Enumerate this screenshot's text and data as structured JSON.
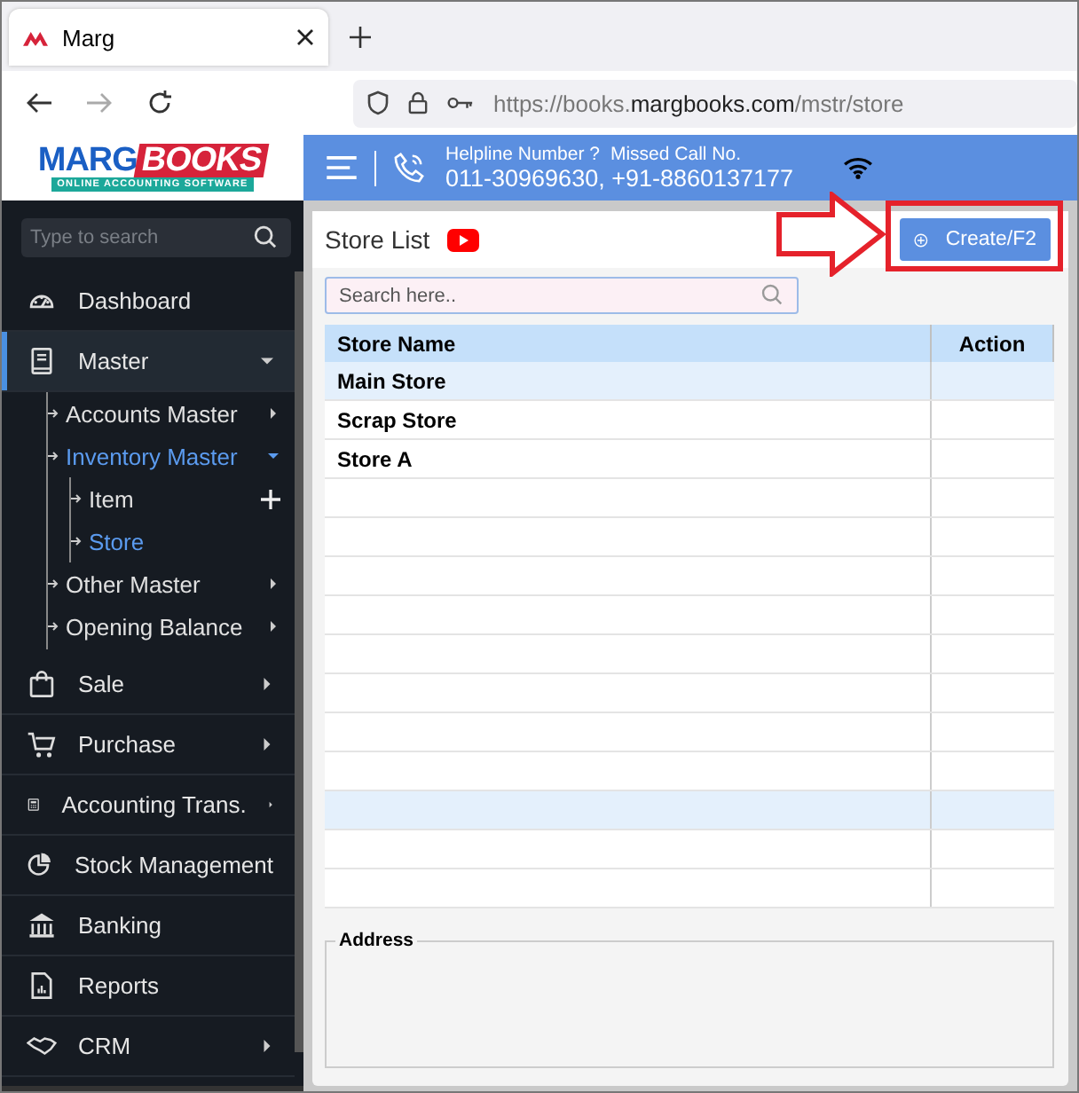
{
  "browser": {
    "tab": {
      "title": "Marg"
    },
    "url": {
      "prefix": "https://books.",
      "domain": "margbooks.com",
      "path": "/mstr/store"
    }
  },
  "logo": {
    "left": "MARG",
    "right": "BOOKS",
    "tagline": "ONLINE ACCOUNTING SOFTWARE"
  },
  "header": {
    "helpline_label": "Helpline Number ?",
    "missed_call_label": "Missed Call No.",
    "numbers": "011-30969630, +91-8860137177"
  },
  "sidebar": {
    "search": {
      "placeholder": "Type to search"
    },
    "items": [
      {
        "label": "Dashboard",
        "kind": "link",
        "selected": false
      },
      {
        "label": "Master",
        "kind": "menu",
        "expanded": true,
        "selected": true,
        "children": [
          {
            "label": "Accounts Master",
            "kind": "menu",
            "expanded": false,
            "selected": false
          },
          {
            "label": "Inventory Master",
            "kind": "menu",
            "expanded": true,
            "selected": true,
            "children": [
              {
                "label": "Item",
                "kind": "add",
                "selected": false
              },
              {
                "label": "Store",
                "kind": "link",
                "selected": true
              }
            ]
          },
          {
            "label": "Other Master",
            "kind": "menu",
            "expanded": false,
            "selected": false
          },
          {
            "label": "Opening Balance",
            "kind": "menu",
            "expanded": false,
            "selected": false
          }
        ]
      },
      {
        "label": "Sale",
        "kind": "menu",
        "expanded": false,
        "selected": false
      },
      {
        "label": "Purchase",
        "kind": "menu",
        "expanded": false,
        "selected": false
      },
      {
        "label": "Accounting Trans.",
        "kind": "menu",
        "expanded": false,
        "selected": false
      },
      {
        "label": "Stock Management",
        "kind": "link",
        "selected": false
      },
      {
        "label": "Banking",
        "kind": "link",
        "selected": false
      },
      {
        "label": "Reports",
        "kind": "link",
        "selected": false
      },
      {
        "label": "CRM",
        "kind": "menu",
        "expanded": false,
        "selected": false
      }
    ]
  },
  "panel": {
    "title": "Store List",
    "create_button": "Create/F2",
    "search": {
      "placeholder": "Search here.."
    },
    "table": {
      "columns": [
        "Store Name",
        "Action"
      ],
      "rows": [
        {
          "name": "Main Store",
          "highlighted": true
        },
        {
          "name": "Scrap Store",
          "highlighted": false
        },
        {
          "name": "Store A",
          "highlighted": false
        },
        {
          "highlighted": false
        },
        {
          "highlighted": false
        },
        {
          "highlighted": false
        },
        {
          "highlighted": false
        },
        {
          "highlighted": false
        },
        {
          "highlighted": false
        },
        {
          "highlighted": false
        },
        {
          "highlighted": false
        },
        {
          "highlighted": true
        },
        {
          "highlighted": false
        },
        {
          "highlighted": false
        }
      ]
    },
    "address": {
      "legend": "Address"
    }
  }
}
